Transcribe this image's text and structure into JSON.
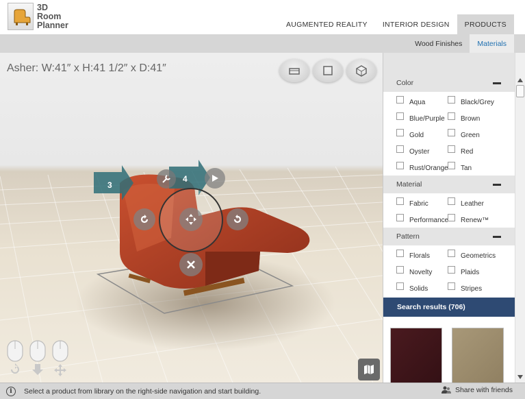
{
  "app": {
    "logo_lines": [
      "3D",
      "Room",
      "Planner"
    ]
  },
  "topnav": {
    "items": [
      {
        "label": "AUGMENTED REALITY",
        "active": false
      },
      {
        "label": "INTERIOR DESIGN",
        "active": false
      },
      {
        "label": "PRODUCTS",
        "active": true
      }
    ]
  },
  "subnav": {
    "items": [
      {
        "label": "Wood Finishes",
        "active": false
      },
      {
        "label": "Materials",
        "active": true
      }
    ]
  },
  "viewport": {
    "product_dims": "Asher: W:41″ x H:41 1/2″ x D:41″",
    "arrow_left_label": "3",
    "arrow_right_label": "4",
    "view_buttons": [
      "floor-view-icon",
      "top-view-icon",
      "3d-view-icon"
    ]
  },
  "filters": {
    "color": {
      "title": "Color",
      "options": [
        "Aqua",
        "Black/Grey",
        "Blue/Purple",
        "Brown",
        "Gold",
        "Green",
        "Oyster",
        "Red",
        "Rust/Orange",
        "Tan"
      ]
    },
    "material": {
      "title": "Material",
      "options": [
        "Fabric",
        "Leather",
        "Performance",
        "Renew™"
      ]
    },
    "pattern": {
      "title": "Pattern",
      "options": [
        "Florals",
        "Geometrics",
        "Novelty",
        "Plaids",
        "Solids",
        "Stripes"
      ]
    }
  },
  "results": {
    "title": "Search results (706)",
    "swatch_colors": [
      "#4a1a1f",
      "#a89878"
    ]
  },
  "statusbar": {
    "text": "Select a product from library on the right-side navigation and start building.",
    "share_label": "Share with friends"
  },
  "colors": {
    "chair": "#b8442a",
    "arrow_teal": "#2f6f78",
    "results_header": "#2e4a73",
    "active_link": "#1e6fb0"
  }
}
